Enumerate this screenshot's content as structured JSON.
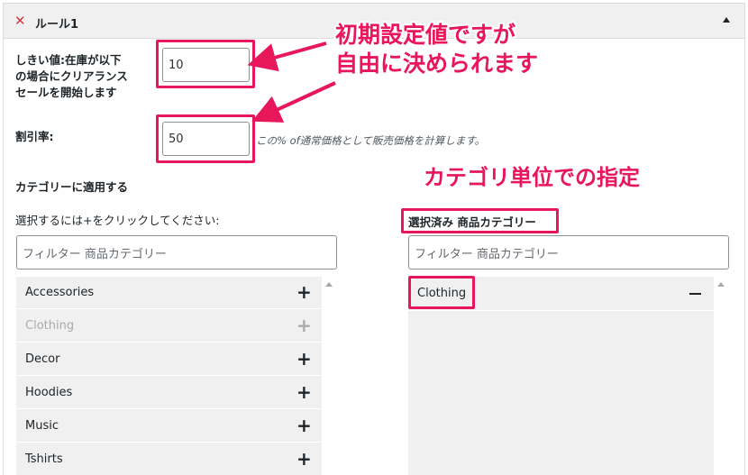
{
  "rule": {
    "title": "ルール1",
    "remove_icon": "close-icon",
    "collapse_icon": "triangle-up-icon"
  },
  "threshold": {
    "label_line1": "しきい値:在庫が以下",
    "label_line2": "の場合にクリアランス",
    "label_line3": "セールを開始します",
    "value": "10"
  },
  "discount": {
    "label": "割引率:",
    "value": "50",
    "hint": "この% of通常価格として販売価格を計算します。"
  },
  "categories": {
    "heading": "カテゴリーに適用する",
    "instruction": "選択するには+をクリックしてください:",
    "filter_placeholder": "フィルター 商品カテゴリー",
    "available": [
      {
        "label": "Accessories",
        "disabled": false
      },
      {
        "label": "Clothing",
        "disabled": true
      },
      {
        "label": "Decor",
        "disabled": false
      },
      {
        "label": "Hoodies",
        "disabled": false
      },
      {
        "label": "Music",
        "disabled": false
      },
      {
        "label": "Tshirts",
        "disabled": false
      }
    ],
    "selected_heading": "選択済み 商品カテゴリー",
    "selected_filter_placeholder": "フィルター 商品カテゴリー",
    "selected": [
      {
        "label": "Clothing"
      }
    ]
  },
  "annotations": {
    "callout_line1": "初期設定値ですが",
    "callout_line2": "自由に決められます",
    "category_note": "カテゴリ単位での指定",
    "color": "#e8165a"
  }
}
